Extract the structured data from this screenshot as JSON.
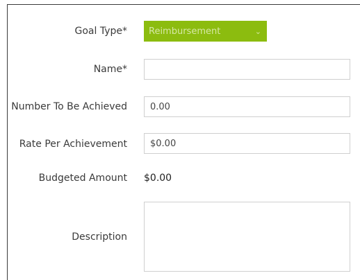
{
  "form": {
    "goal_type": {
      "label": "Goal Type*",
      "value": "Reimbursement",
      "accent_color": "#8cbc0f",
      "icon": "chevron-down-icon"
    },
    "name": {
      "label": "Name*",
      "value": ""
    },
    "number_to_be_achieved": {
      "label": "Number To Be Achieved",
      "value": "0.00"
    },
    "rate_per_achievement": {
      "label": "Rate Per Achievement",
      "value": "$0.00"
    },
    "budgeted_amount": {
      "label": "Budgeted Amount",
      "value": "$0.00"
    },
    "description": {
      "label": "Description",
      "value": ""
    }
  }
}
